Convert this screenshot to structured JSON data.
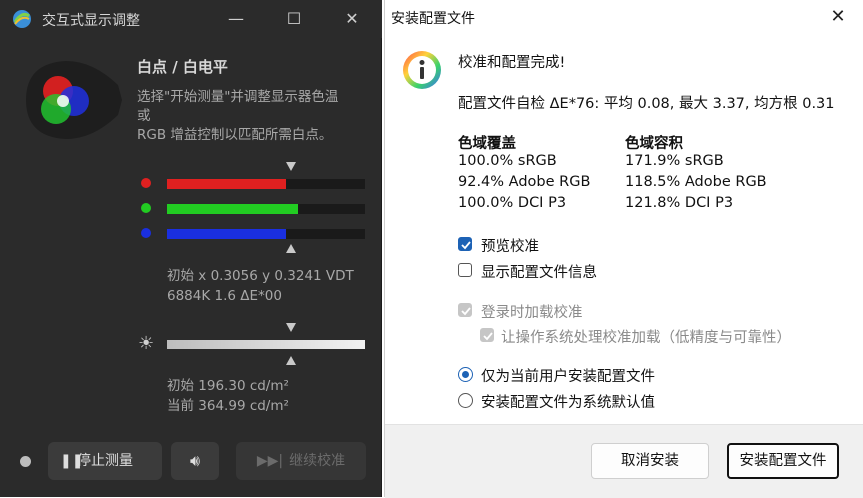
{
  "left_window": {
    "title": "交互式显示调整",
    "heading": "白点 / 白电平",
    "desc_line1": "选择\"开始测量\"并调整显示器色温",
    "desc_line2": "或",
    "desc_line3": "RGB 增益控制以匹配所需白点。",
    "channels": [
      {
        "name": "red",
        "color": "#e02020",
        "level": 0.6
      },
      {
        "name": "green",
        "color": "#22cc22",
        "level": 0.66
      },
      {
        "name": "blue",
        "color": "#1a2fe0",
        "level": 0.6
      }
    ],
    "whitepoint_line1": "初始 x 0.3056 y 0.3241 VDT",
    "whitepoint_line2": "6884K 1.6 ΔE*00",
    "luminance_level": 1.0,
    "initial_luminance": "初始 196.30 cd/m²",
    "current_luminance": "当前 364.99 cd/m²",
    "stop_label": "停止测量",
    "continue_label": "继续校准",
    "icons": {
      "app": "app-logo-icon",
      "sun": "brightness-icon",
      "speaker": "speaker-icon",
      "pause": "pause-icon",
      "skip": "skip-forward-icon"
    }
  },
  "dialog": {
    "title": "安装配置文件",
    "message": "校准和配置完成!",
    "selfcheck": "配置文件自检 ΔE*76: 平均 0.08, 最大 3.37, 均方根 0.31",
    "gamut_coverage": {
      "title": "色域覆盖",
      "rows": [
        "100.0% sRGB",
        "92.4% Adobe RGB",
        "100.0% DCI P3"
      ]
    },
    "gamut_volume": {
      "title": "色域容积",
      "rows": [
        "171.9% sRGB",
        "118.5% Adobe RGB",
        "121.8% DCI P3"
      ]
    },
    "options": {
      "preview": "预览校准",
      "show_info": "显示配置文件信息",
      "load_on_login": "登录时加载校准",
      "os_handling": "让操作系统处理校准加载（低精度与可靠性）",
      "install_current_user": "仅为当前用户安装配置文件",
      "install_system_default": "安装配置文件为系统默认值"
    },
    "cancel_label": "取消安装",
    "install_label": "安装配置文件",
    "accent": "#1d62b5"
  }
}
